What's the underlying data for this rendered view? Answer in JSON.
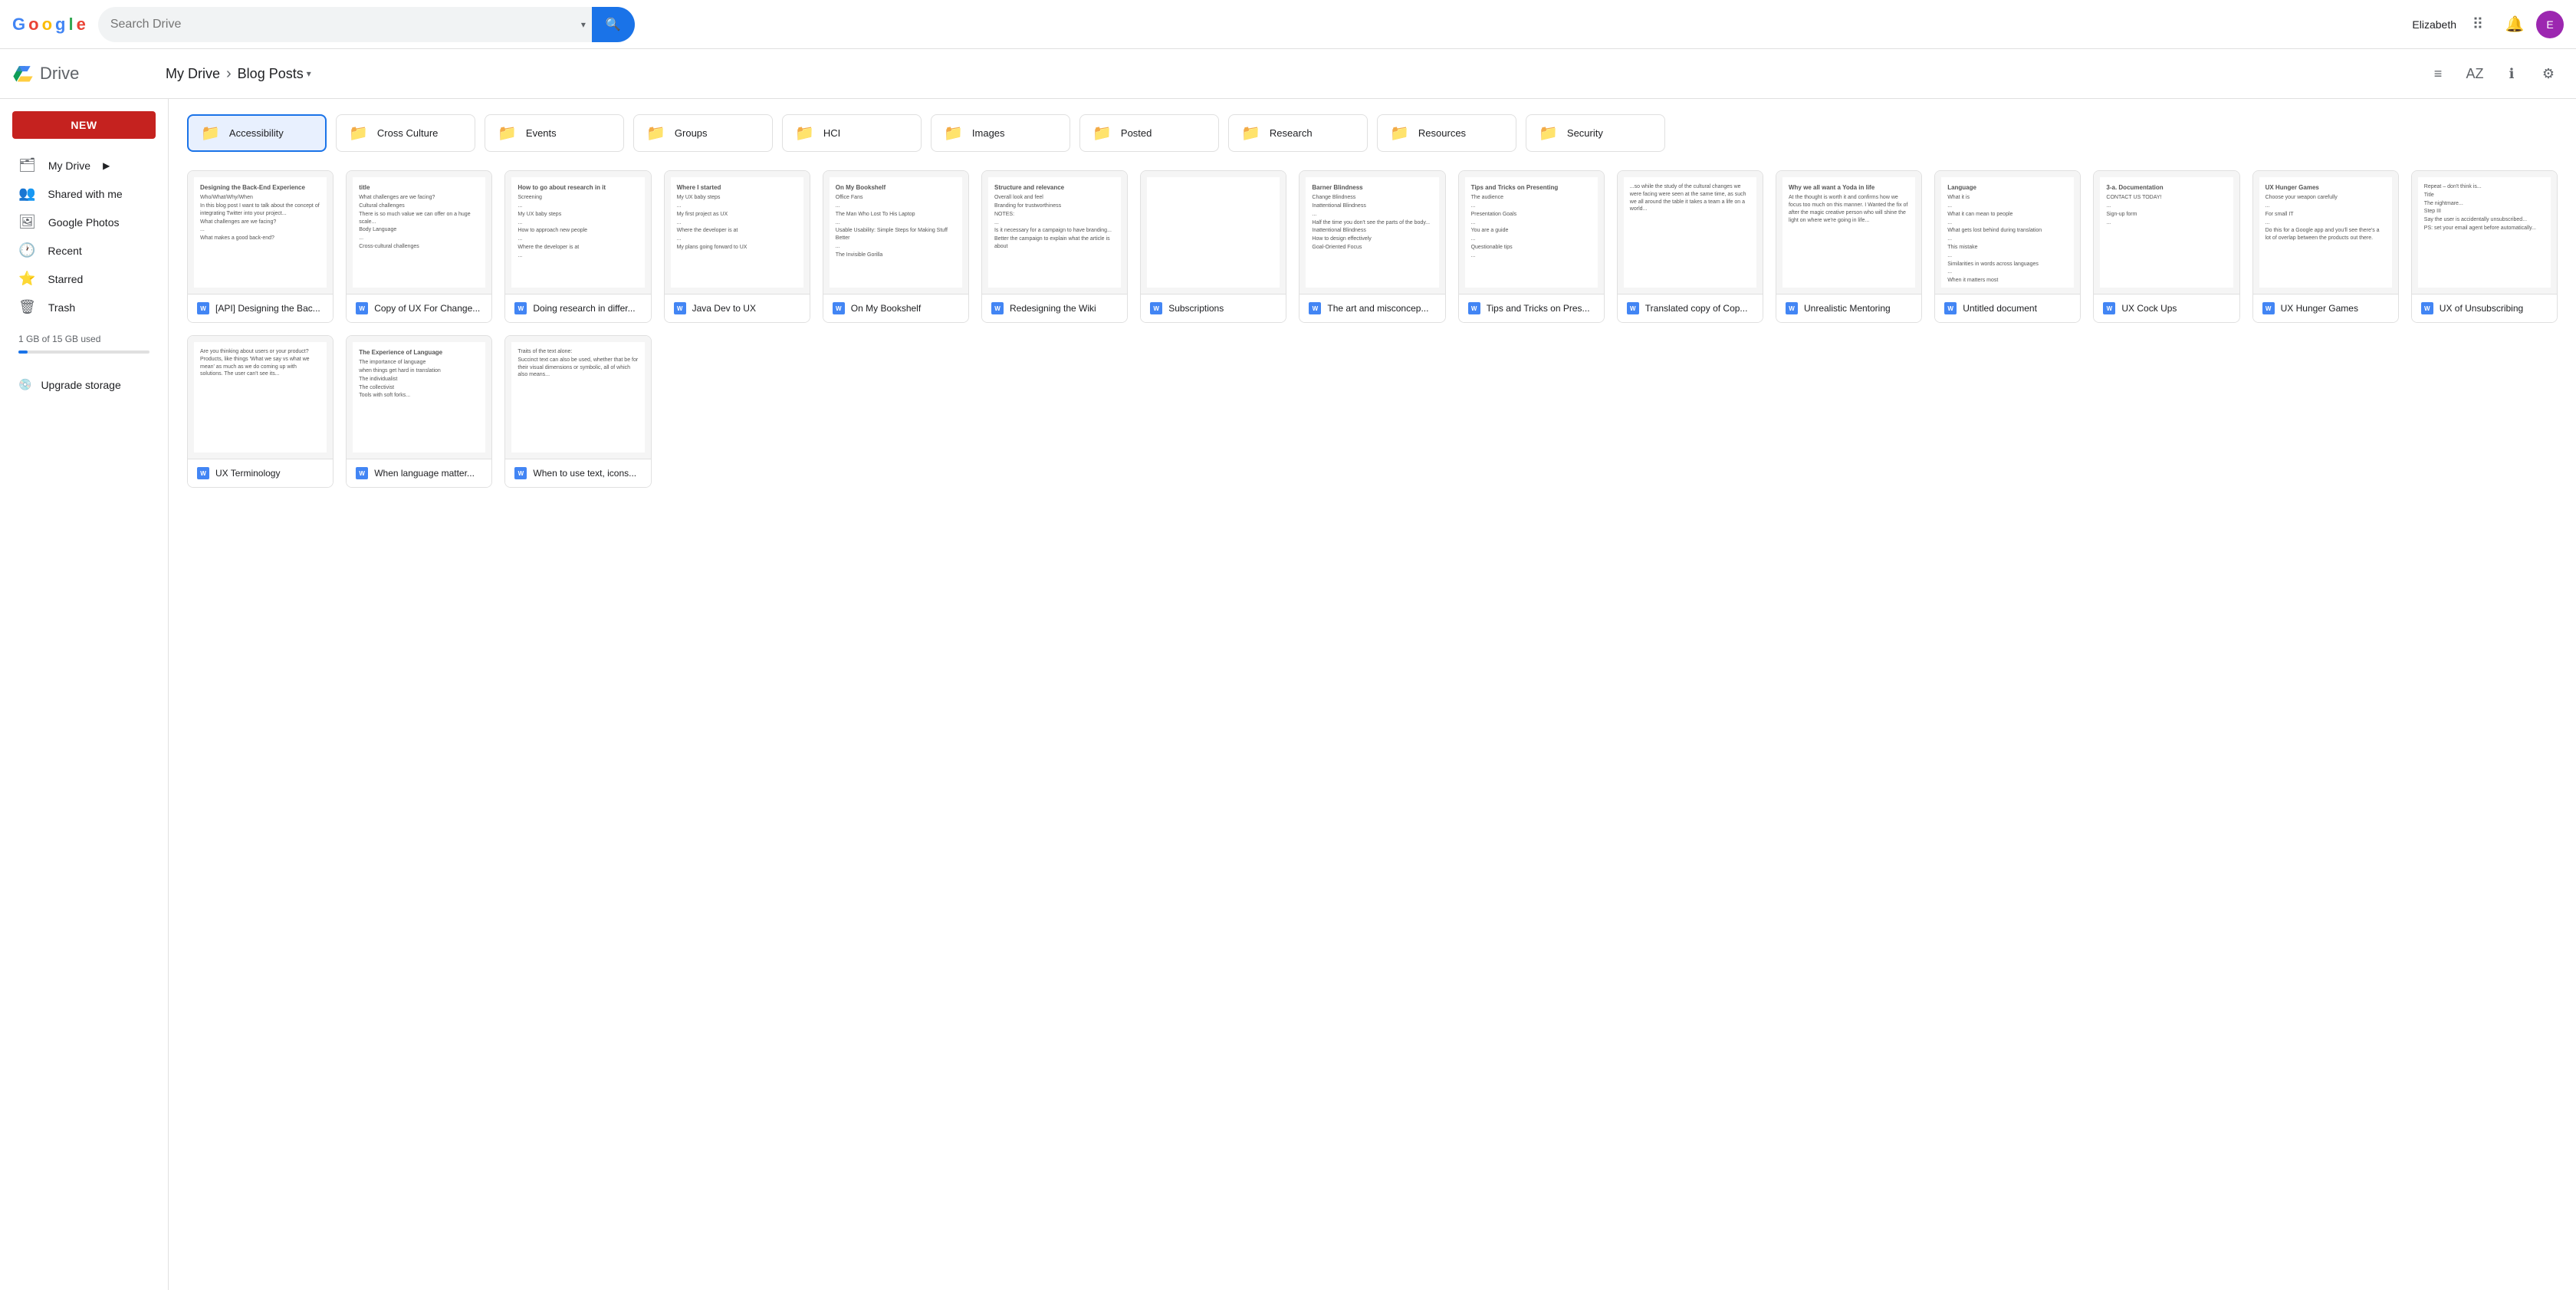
{
  "topbar": {
    "search_placeholder": "Search Drive",
    "user_name": "Elizabeth",
    "chevron": "▾"
  },
  "drive_header": {
    "title": "Drive",
    "breadcrumb_root": "My Drive",
    "breadcrumb_sep": "›",
    "breadcrumb_current": "Blog Posts",
    "chevron": "▾"
  },
  "view_icons": {
    "list": "≡",
    "sort": "AZ",
    "info": "ℹ",
    "settings": "⚙"
  },
  "sidebar": {
    "new_btn": "NEW",
    "items": [
      {
        "id": "my-drive",
        "label": "My Drive",
        "icon": "🗂",
        "expandable": true
      },
      {
        "id": "shared",
        "label": "Shared with me",
        "icon": "👥"
      },
      {
        "id": "photos",
        "label": "Google Photos",
        "icon": "🖼"
      },
      {
        "id": "recent",
        "label": "Recent",
        "icon": "🕐"
      },
      {
        "id": "starred",
        "label": "Starred",
        "icon": "⭐"
      },
      {
        "id": "trash",
        "label": "Trash",
        "icon": "🗑"
      }
    ],
    "storage_text": "1 GB of 15 GB used",
    "upgrade_label": "Upgrade storage",
    "upgrade_icon": "💿"
  },
  "folders": [
    {
      "name": "Accessibility",
      "selected": true
    },
    {
      "name": "Cross Culture"
    },
    {
      "name": "Events"
    },
    {
      "name": "Groups"
    },
    {
      "name": "HCI"
    },
    {
      "name": "Images"
    },
    {
      "name": "Posted"
    },
    {
      "name": "Research"
    },
    {
      "name": "Resources"
    },
    {
      "name": "Security"
    }
  ],
  "files": [
    {
      "name": "[API] Designing the Bac...",
      "preview_title": "Designing the Back-End Experience",
      "preview_text": "Who/What/Why/When\nIn this blog post I want to talk about the concept of integrating Twitter into your project...\n\nWhat challenges are we facing?\n...\n\nWhat makes a good back-end?"
    },
    {
      "name": "Copy of UX For Change...",
      "preview_title": "title",
      "preview_text": "What challenges are we facing?\n\nCultural challenges\nThere is so much value we can offer on a huge scale...\n\nBody Language\n...\n\nCross-cultural challenges"
    },
    {
      "name": "Doing research in differ...",
      "preview_title": "How to go about research in it",
      "preview_text": "Screening\n...\nMy UX baby steps\n...\nHow to approach new people\n...\nWhere the developer is at\n..."
    },
    {
      "name": "Java Dev to UX",
      "preview_title": "Where I started",
      "preview_text": "My UX baby steps\n...\nMy first project as UX\n...\nWhere the developer is at\n...\nMy plans going forward to UX"
    },
    {
      "name": "On My Bookshelf",
      "preview_title": "On My Bookshelf",
      "preview_text": "Office Fans\n...\nThe Man Who Lost To His Laptop\n...\nUsable Usability: Simple Steps for Making Stuff Better\n...\nThe Invisible Gorilla"
    },
    {
      "name": "Redesigning the Wiki",
      "preview_title": "Structure and relevance",
      "preview_text": "Overall look and feel\nBranding for trustworthiness\n\nNOTES:\n...\nIs it necessary for a campaign to have branding...\nBetter the campaign to explain what the article is about"
    },
    {
      "name": "Subscriptions",
      "preview_title": "",
      "preview_text": ""
    },
    {
      "name": "The art and misconcep...",
      "preview_title": "Barner Blindness",
      "preview_text": "Change Blindness\nInattentional Blindness\n...\nHalf the time you don't see the parts of the body...\n\nInattentional Blindness\n\nHow to design effectively\nGoal-Oriented Focus"
    },
    {
      "name": "Tips and Tricks on Pres...",
      "preview_title": "Tips and Tricks on Presenting",
      "preview_text": "The audience\n...\nPresentation Goals\n...\nYou are a guide\n...\nQuestionable tips\n..."
    },
    {
      "name": "Translated copy of Cop...",
      "preview_title": "",
      "preview_text": "...so while the study of the cultural changes we were facing were seen at the same time, as such we all around the table it takes a team a life on a world..."
    },
    {
      "name": "Unrealistic Mentoring",
      "preview_title": "Why we all want a Yoda in life",
      "preview_text": "At the thought is worth it and confirms how we focus too much on this manner. I Wanted the fix of after the magic creative person who will shine the light on where we're going in life..."
    },
    {
      "name": "Untitled document",
      "preview_title": "Language",
      "preview_text": "What it is\n...\nWhat it can mean to people\n...\nWhat gets lost behind during translation\n...\nThis mistake\n...\nSimilarities in words across languages\n...\nWhen it matters most\n...\nDebates"
    },
    {
      "name": "UX Cock Ups",
      "preview_title": "3-a. Documentation",
      "preview_text": "CONTACT US TODAY!\n...\nSign-up form\n..."
    },
    {
      "name": "UX Hunger Games",
      "preview_title": "UX Hunger Games",
      "preview_text": "Choose your weapon carefully\n...\nFor small IT\n...\nDo this for a Google app and you'll see there's a lot of overlap between the products out there."
    },
    {
      "name": "UX of Unsubscribing",
      "preview_title": "",
      "preview_text": "Repeat – don't think is...\n\nTitle\nThe nightmare...\n\nStep III\nSay the user is accidentally unsubscribed...\n\nPS: set your email agent before automatically..."
    },
    {
      "name": "UX Terminology",
      "preview_title": "",
      "preview_text": "Are you thinking about users or your product? Products, like things 'What we say vs what we mean' as much as we do coming up with solutions. The user can't see its..."
    },
    {
      "name": "When language matter...",
      "preview_title": "The Experience of Language",
      "preview_text": "The importance of language\nwhen things get hard in translation\n\nThe individualist\n\nThe collectivist\n\nTools with soft forks..."
    },
    {
      "name": "When to use text, icons...",
      "preview_title": "",
      "preview_text": "Traits of the text alone:\nSuccinct text can also be used, whether that be for their visual dimensions or symbolic, all of which also means..."
    }
  ]
}
